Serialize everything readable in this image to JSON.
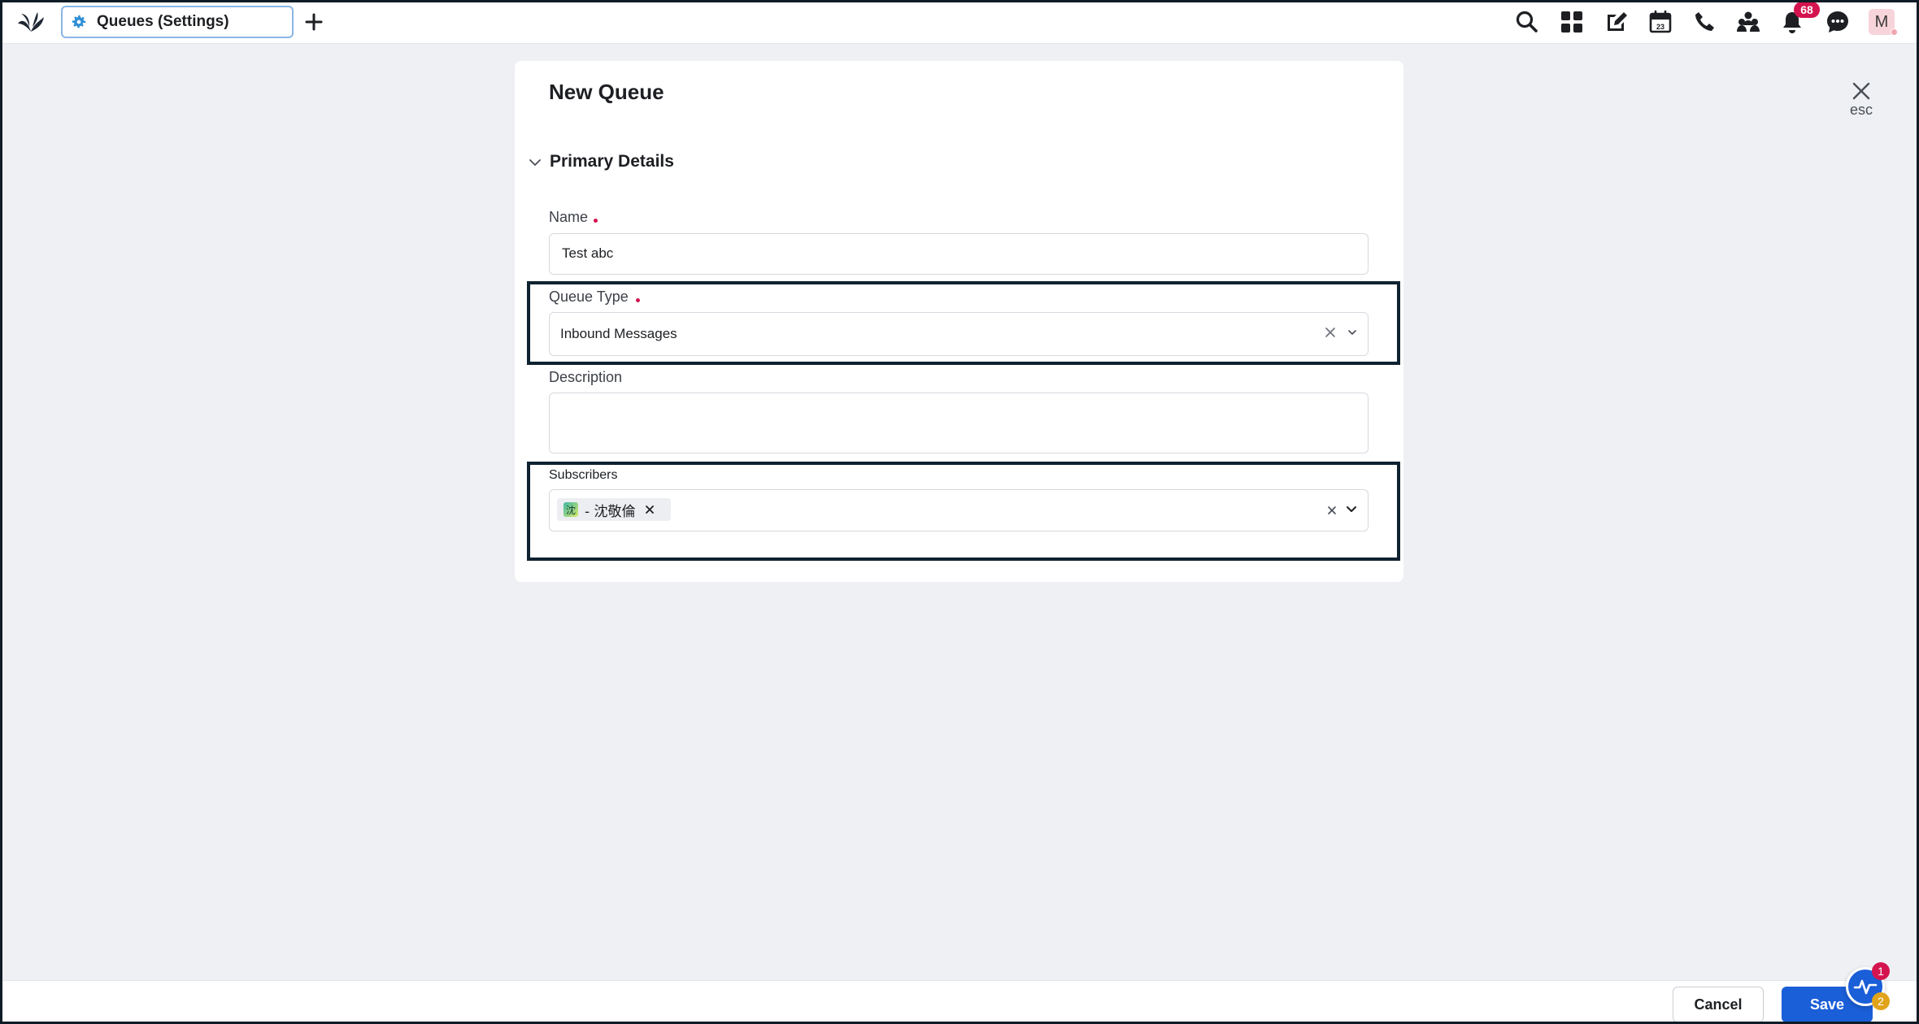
{
  "colors": {
    "brand": "#1a5ed8",
    "required": "#d4144f",
    "badge": "#d4144f",
    "highlight_border": "#0f2230"
  },
  "topbar": {
    "tab_label": "Queues (Settings)",
    "tab_icon": "gear-icon",
    "notification_count": "68",
    "avatar_initial": "M",
    "icons": [
      "search-icon",
      "apps-grid-icon",
      "edit-icon",
      "calendar-icon",
      "phone-icon",
      "team-icon",
      "bell-icon",
      "chat-icon"
    ],
    "calendar_day": "23"
  },
  "modal": {
    "close_label": "esc",
    "title": "New Queue",
    "section_title": "Primary Details",
    "fields": {
      "name": {
        "label": "Name",
        "value": "Test abc",
        "required": true
      },
      "queue_type": {
        "label": "Queue Type",
        "value": "Inbound Messages",
        "required": true
      },
      "description": {
        "label": "Description",
        "value": ""
      },
      "subscribers": {
        "label": "Subscribers",
        "chips": [
          {
            "initial": "沈",
            "text": "- 沈敬倫"
          }
        ]
      }
    }
  },
  "footer": {
    "cancel_label": "Cancel",
    "save_label": "Save",
    "activity_badge_primary": "1",
    "activity_badge_secondary": "2"
  }
}
